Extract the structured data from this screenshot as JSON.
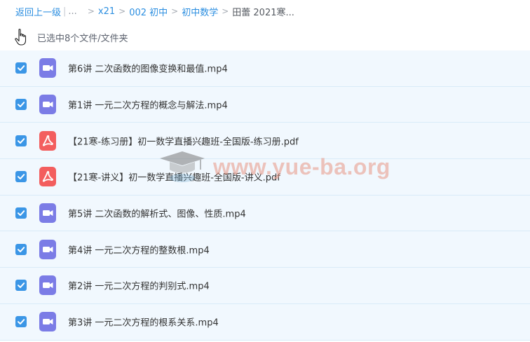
{
  "breadcrumb": {
    "back_label": "返回上一级",
    "ellipsis": "...",
    "items": [
      "x21",
      "002 初中",
      "初中数学"
    ],
    "current": "田蕾 2021寒..."
  },
  "selection": {
    "status_text": "已选中8个文件/文件夹"
  },
  "files": [
    {
      "name": "第6讲 二次函数的图像变换和最值.mp4",
      "type": "video"
    },
    {
      "name": "第1讲 一元二次方程的概念与解法.mp4",
      "type": "video"
    },
    {
      "name": "【21寒-练习册】初一数学直播兴趣班-全国版-练习册.pdf",
      "type": "pdf"
    },
    {
      "name": "【21寒-讲义】初一数学直播兴趣班-全国版-讲义.pdf",
      "type": "pdf"
    },
    {
      "name": "第5讲 二次函数的解析式、图像、性质.mp4",
      "type": "video"
    },
    {
      "name": "第4讲 一元二次方程的整数根.mp4",
      "type": "video"
    },
    {
      "name": "第2讲 一元二次方程的判别式.mp4",
      "type": "video"
    },
    {
      "name": "第3讲 一元二次方程的根系关系.mp4",
      "type": "video"
    }
  ],
  "watermark": {
    "text": "www.yue-ba.org"
  },
  "colors": {
    "link": "#2b8ee0",
    "checkbox": "#3b96e6",
    "video_icon": "#7b7ce6",
    "pdf_icon": "#f35e5e",
    "row_background": "#f1f8fe"
  }
}
